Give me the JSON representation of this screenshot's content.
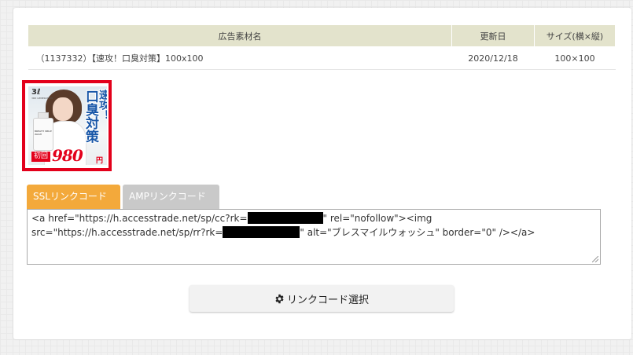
{
  "table": {
    "headers": [
      "広告素材名",
      "更新日",
      "サイズ(横×縦)"
    ],
    "row": {
      "name": "（1137332）【速攻！口臭対策】100x100",
      "date": "2020/12/18",
      "size": "100×100"
    }
  },
  "banner": {
    "logo": "3ℓ",
    "logo_sub": "3RD GENERATION",
    "bottle_label": "BREATH SMILE WASH",
    "text_line1": "速攻！",
    "text_line2": "口臭対策",
    "badge": "初回",
    "price": "980",
    "yen": "円",
    "accent_color": "#e3001b",
    "frame_color": "#e3001b"
  },
  "tabs": [
    {
      "label": "SSLリンクコード",
      "active": true,
      "color": "#f3a93b"
    },
    {
      "label": "AMPリンクコード",
      "active": false,
      "color": "#c9c9c9"
    }
  ],
  "code": {
    "line1_a": "<a href=\"https://h.accesstrade.net/sp/cc?rk=",
    "line1_b": "\" rel=\"nofollow\"><img",
    "line2_a": "src=\"https://h.accesstrade.net/sp/rr?rk=",
    "line2_b": "\" alt=\"ブレスマイルウォッシュ\" border=\"0\" /></a>"
  },
  "select_button": {
    "icon": "gear-icon",
    "label": "リンクコード選択"
  }
}
